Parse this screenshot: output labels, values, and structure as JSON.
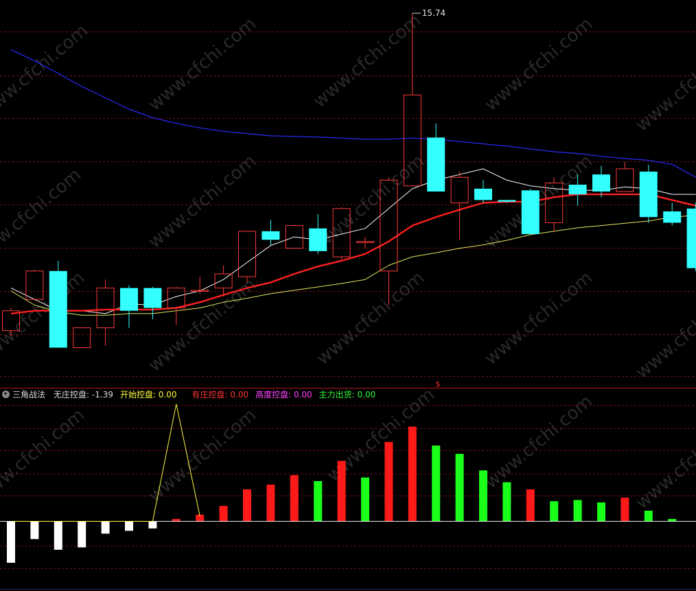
{
  "indicator": {
    "title": "三角战法",
    "legend": [
      {
        "label": "无庄控盘: -1.39",
        "color": "#dddddd"
      },
      {
        "label": "开始控盘: 0.00",
        "color": "#ffff3c"
      },
      {
        "label": "有庄控盘: 0.00",
        "color": "#ff3333"
      },
      {
        "label": "高度控盘: 0.00",
        "color": "#ff44ff"
      },
      {
        "label": "主力出货: 0.00",
        "color": "#33ff33"
      }
    ]
  },
  "price_chart": {
    "max_label": "15.74",
    "marker": "$",
    "watermark": "www.cfchi.com"
  },
  "chart_data": [
    {
      "type": "candlestick",
      "title": "",
      "ylim": [
        9.3,
        15.9
      ],
      "candles": [
        {
          "open": 10.15,
          "close": 10.5,
          "high": 10.55,
          "low": 10.05
        },
        {
          "open": 10.7,
          "close": 11.2,
          "high": 11.22,
          "low": 10.68
        },
        {
          "open": 11.2,
          "close": 9.85,
          "high": 11.38,
          "low": 9.85
        },
        {
          "open": 9.85,
          "close": 10.2,
          "high": 10.2,
          "low": 9.85
        },
        {
          "open": 10.2,
          "close": 10.9,
          "high": 11.05,
          "low": 9.88
        },
        {
          "open": 10.9,
          "close": 10.5,
          "high": 10.95,
          "low": 10.2
        },
        {
          "open": 10.9,
          "close": 10.55,
          "high": 10.92,
          "low": 10.35
        },
        {
          "open": 10.55,
          "close": 10.9,
          "high": 10.92,
          "low": 10.25
        },
        {
          "open": 10.85,
          "close": 10.86,
          "high": 11.1,
          "low": 10.8
        },
        {
          "open": 10.9,
          "close": 11.15,
          "high": 11.3,
          "low": 10.75
        },
        {
          "open": 11.1,
          "close": 11.9,
          "high": 11.9,
          "low": 11.0
        },
        {
          "open": 11.9,
          "close": 11.75,
          "high": 12.1,
          "low": 11.65
        },
        {
          "open": 11.6,
          "close": 12.0,
          "high": 12.02,
          "low": 11.6
        },
        {
          "open": 11.95,
          "close": 11.55,
          "high": 12.2,
          "low": 11.5
        },
        {
          "open": 11.45,
          "close": 12.3,
          "high": 12.32,
          "low": 11.4
        },
        {
          "open": 11.7,
          "close": 11.72,
          "high": 11.8,
          "low": 11.6
        },
        {
          "open": 11.2,
          "close": 12.8,
          "high": 12.85,
          "low": 10.6
        },
        {
          "open": 12.7,
          "close": 14.3,
          "high": 15.74,
          "low": 12.7
        },
        {
          "open": 13.55,
          "close": 12.6,
          "high": 13.8,
          "low": 12.6
        },
        {
          "open": 12.4,
          "close": 12.85,
          "high": 12.95,
          "low": 11.75
        },
        {
          "open": 12.65,
          "close": 12.45,
          "high": 12.8,
          "low": 12.4
        },
        {
          "open": 12.45,
          "close": 12.42,
          "high": 12.45,
          "low": 12.4
        },
        {
          "open": 12.62,
          "close": 11.85,
          "high": 12.65,
          "low": 11.85
        },
        {
          "open": 12.05,
          "close": 12.75,
          "high": 12.85,
          "low": 11.9
        },
        {
          "open": 12.72,
          "close": 12.55,
          "high": 12.9,
          "low": 12.35
        },
        {
          "open": 12.9,
          "close": 12.6,
          "high": 13.05,
          "low": 12.5
        },
        {
          "open": 12.6,
          "close": 13.0,
          "high": 13.12,
          "low": 12.6
        },
        {
          "open": 12.95,
          "close": 12.15,
          "high": 13.07,
          "low": 12.05
        },
        {
          "open": 12.25,
          "close": 12.05,
          "high": 12.4,
          "low": 12.0
        },
        {
          "open": 12.3,
          "close": 11.25,
          "high": 12.4,
          "low": 11.2
        }
      ],
      "series": [
        {
          "color": "#ffffff",
          "values": [
            10.9,
            10.7,
            10.5,
            10.5,
            10.45,
            10.62,
            10.6,
            10.75,
            10.85,
            11.05,
            11.35,
            11.65,
            11.8,
            11.75,
            11.85,
            11.95,
            12.3,
            12.65,
            12.8,
            12.9,
            13.0,
            12.8,
            12.7,
            12.65,
            12.62,
            12.62,
            12.68,
            12.65,
            12.55,
            12.55
          ]
        },
        {
          "color": "#ff2020",
          "values": [
            10.45,
            10.5,
            10.5,
            10.5,
            10.52,
            10.52,
            10.52,
            10.55,
            10.65,
            10.78,
            10.9,
            11.0,
            11.15,
            11.28,
            11.38,
            11.5,
            11.72,
            12.0,
            12.15,
            12.28,
            12.4,
            12.42,
            12.42,
            12.5,
            12.55,
            12.55,
            12.55,
            12.55,
            12.45,
            12.35
          ]
        },
        {
          "color": "#e8e860",
          "values": [
            10.85,
            10.6,
            10.48,
            10.42,
            10.42,
            10.45,
            10.45,
            10.5,
            10.55,
            10.65,
            10.72,
            10.8,
            10.86,
            10.92,
            10.98,
            11.05,
            11.3,
            11.45,
            11.52,
            11.6,
            11.66,
            11.74,
            11.84,
            11.9,
            11.96,
            12.0,
            12.04,
            12.08,
            12.15,
            12.18
          ]
        },
        {
          "color": "#2a2aff",
          "values": [
            15.1,
            14.9,
            14.68,
            14.45,
            14.25,
            14.05,
            13.9,
            13.8,
            13.72,
            13.66,
            13.62,
            13.58,
            13.57,
            13.56,
            13.54,
            13.52,
            13.52,
            13.54,
            13.52,
            13.48,
            13.44,
            13.4,
            13.35,
            13.3,
            13.27,
            13.22,
            13.18,
            13.15,
            13.08,
            12.85
          ]
        }
      ]
    },
    {
      "type": "bar",
      "title": "三角战法",
      "ylim": [
        -1.6,
        4.8
      ],
      "series": [
        {
          "name": "无庄控盘",
          "color": "#ffffff",
          "values": [
            -1.75,
            -0.75,
            -1.2,
            -1.1,
            -0.52,
            -0.4,
            -0.3
          ]
        },
        {
          "name": "有庄控盘",
          "color": "#ff1a1a",
          "values": [
            0.1,
            0.28,
            0.65,
            1.35,
            1.55,
            1.95,
            2.55,
            3.35,
            4.0,
            1.35,
            1.0
          ]
        },
        {
          "name": "主力出货",
          "color": "#1aff1a",
          "values": [
            1.7,
            1.85,
            3.2,
            2.85,
            2.15,
            1.65,
            0.85,
            0.9,
            0.8,
            0.45,
            0.1
          ]
        },
        {
          "name": "开始控盘",
          "color": "#ffff00",
          "type": "line",
          "values": [
            0,
            0,
            0,
            0,
            0,
            0,
            0,
            4.95,
            0.22
          ]
        }
      ]
    }
  ]
}
